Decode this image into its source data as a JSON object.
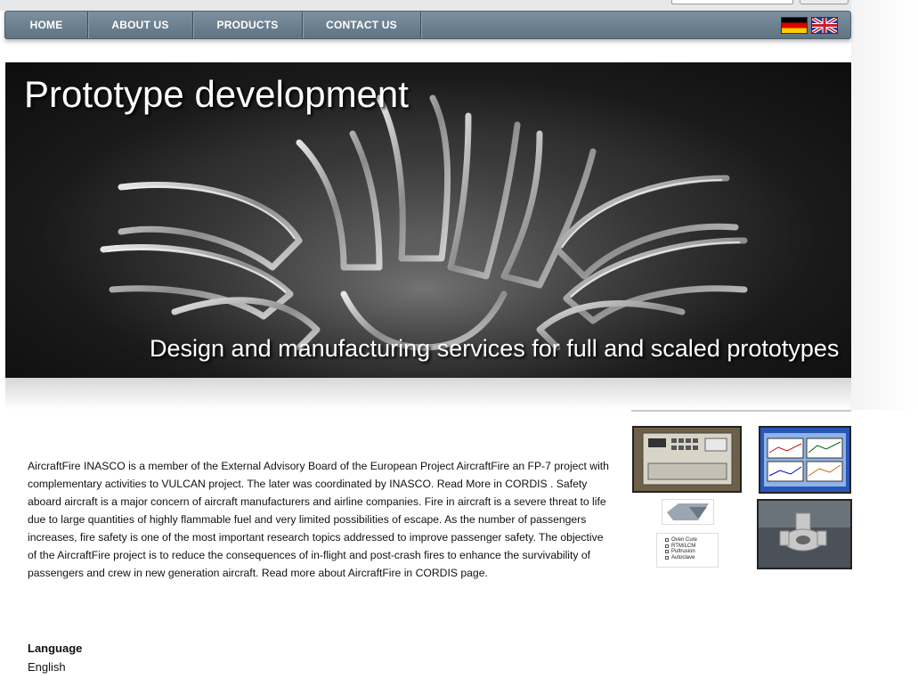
{
  "nav": {
    "items": [
      {
        "label": "HOME"
      },
      {
        "label": "ABOUT US"
      },
      {
        "label": "PRODUCTS"
      },
      {
        "label": "CONTACT US"
      }
    ],
    "flags": [
      "german-flag-icon",
      "uk-flag-icon"
    ]
  },
  "banner": {
    "title": "Prototype development",
    "subtitle": "Design and manufacturing services for full and scaled prototypes"
  },
  "sidebar": {
    "process_list": [
      "Oven Cure",
      "RTM/LCM",
      "Pultrusion",
      "Autoclave"
    ]
  },
  "article": {
    "text": "AircraftFire INASCO is a member of the External Advisory Board of the European Project AircraftFire an FP-7 project with complementary activities to VULCAN project. The later was coordinated by INASCO. Read More in CORDIS . Safety aboard aircraft is a major concern of aircraft manufacturers and airline companies. Fire in aircraft is a severe threat to life due to large quantities of highly flammable fuel and very limited possibilities of escape. As the number of passengers increases, fire safety is one of the most important research topics addressed to improve passenger safety. The objective of the AircraftFire project is to reduce the consequences of in-flight and post-crash fires to enhance the survivability of passengers and crew in new generation aircraft. Read more about AircraftFire in CORDIS page."
  },
  "language": {
    "label": "Language",
    "value": "English"
  },
  "colors": {
    "nav_top": "#7d919f",
    "nav_bottom": "#5f7383"
  }
}
